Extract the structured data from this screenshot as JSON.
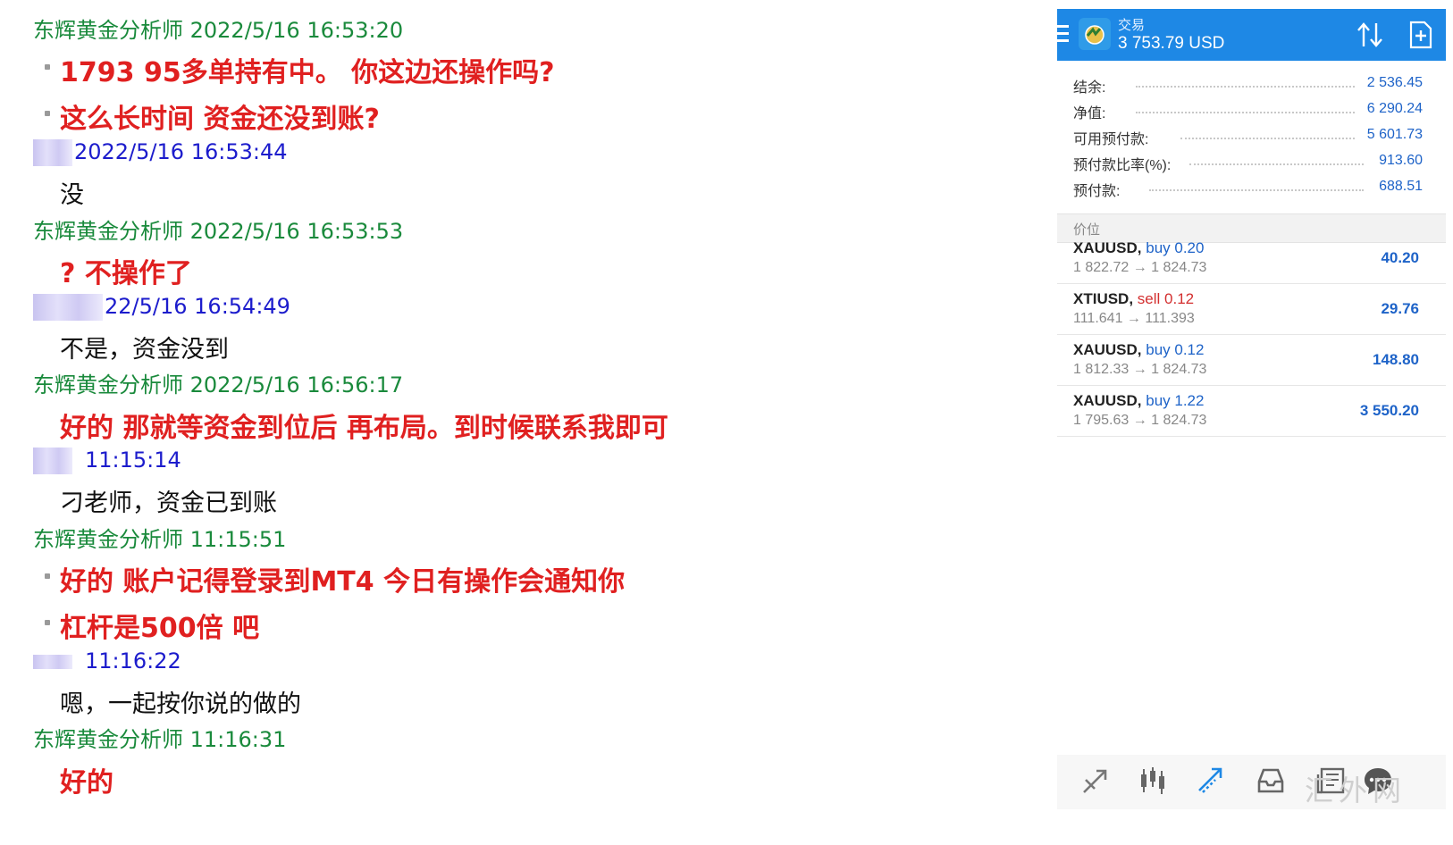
{
  "chat": {
    "h1": "东辉黄金分析师 2022/5/16 16:53:20",
    "m1a": "1793 95多单持有中。  你这边还操作吗?",
    "m1b": "这么长时间 资金还没到账?",
    "h2": "2022/5/16 16:53:44",
    "m2": "没",
    "h3": "东辉黄金分析师 2022/5/16 16:53:53",
    "m3": "? 不操作了",
    "h4": "22/5/16 16:54:49",
    "m4": "不是，资金没到",
    "h5": "东辉黄金分析师 2022/5/16 16:56:17",
    "m5": "好的 那就等资金到位后 再布局。到时候联系我即可",
    "h6": "11:15:14",
    "m6": "刁老师，资金已到账",
    "h7": "东辉黄金分析师  11:15:51",
    "m7a": "好的  账户记得登录到MT4  今日有操作会通知你",
    "m7b": "杠杆是500倍 吧",
    "h8": "11:16:22",
    "m8": "嗯，一起按你说的做的",
    "h9": "东辉黄金分析师  11:16:31",
    "m9": "好的"
  },
  "mt4": {
    "title": "交易",
    "balance_header": "3 753.79 USD",
    "summary": [
      {
        "label": "结余:",
        "value": "2 536.45"
      },
      {
        "label": "净值:",
        "value": "6 290.24"
      },
      {
        "label": "可用预付款:",
        "value": "5 601.73"
      },
      {
        "label": "预付款比率(%):",
        "value": "913.60"
      },
      {
        "label": "预付款:",
        "value": "688.51"
      }
    ],
    "section": "价位",
    "positions": [
      {
        "symbol": "XAUUSD,",
        "dir": "buy 0.20",
        "prices": "1 822.72 → 1 824.73",
        "pl": "40.20"
      },
      {
        "symbol": "XTIUSD,",
        "dir": "sell 0.12",
        "prices": "111.641 → 111.393",
        "pl": "29.76"
      },
      {
        "symbol": "XAUUSD,",
        "dir": "buy 0.12",
        "prices": "1 812.33 → 1 824.73",
        "pl": "148.80"
      },
      {
        "symbol": "XAUUSD,",
        "dir": "buy 1.22",
        "prices": "1 795.63 → 1 824.73",
        "pl": "3 550.20"
      }
    ],
    "colors": {
      "accent": "#1e88e5",
      "buy": "#1e63c8",
      "sell": "#d32f2f"
    }
  },
  "watermark": "汇外网"
}
